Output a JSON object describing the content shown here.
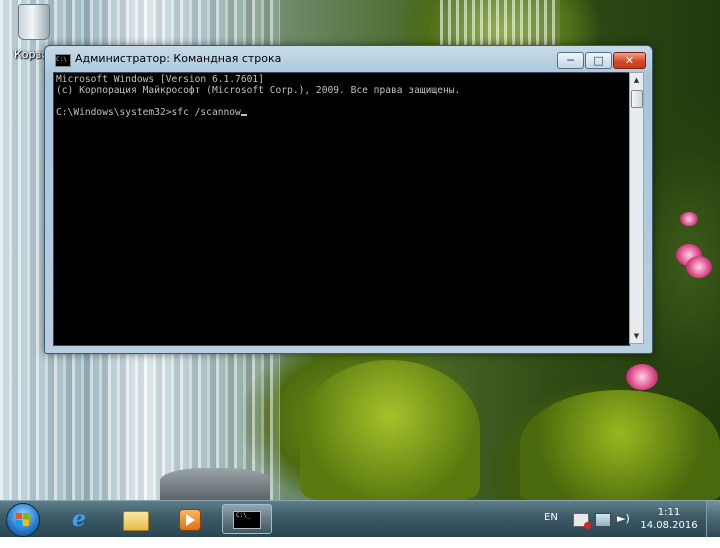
{
  "desktop": {
    "icons": [
      {
        "label": "Корзина",
        "icon": "recycle-bin-icon"
      }
    ]
  },
  "window": {
    "title": "Администратор: Командная строка",
    "icon": "cmd-icon",
    "controls": {
      "minimize": "minimize-icon",
      "maximize": "maximize-icon",
      "close": "close-icon"
    },
    "console": {
      "lines": [
        "Microsoft Windows [Version 6.1.7601]",
        "(c) Корпорация Майкрософт (Microsoft Corp.), 2009. Все права защищены.",
        "",
        "C:\\Windows\\system32>sfc /scannow"
      ]
    }
  },
  "taskbar": {
    "start_icon": "windows-start-icon",
    "pinned": [
      {
        "name": "Internet Explorer",
        "icon": "ie-icon"
      },
      {
        "name": "Проводник",
        "icon": "folder-icon"
      },
      {
        "name": "Windows Media Player",
        "icon": "media-player-icon"
      },
      {
        "name": "Командная строка",
        "icon": "cmd-icon",
        "active": true
      }
    ],
    "tray": {
      "language": "EN",
      "icons": [
        "action-center-flag-icon",
        "network-icon",
        "volume-icon"
      ],
      "time": "1:11",
      "date": "14.08.2016"
    }
  }
}
